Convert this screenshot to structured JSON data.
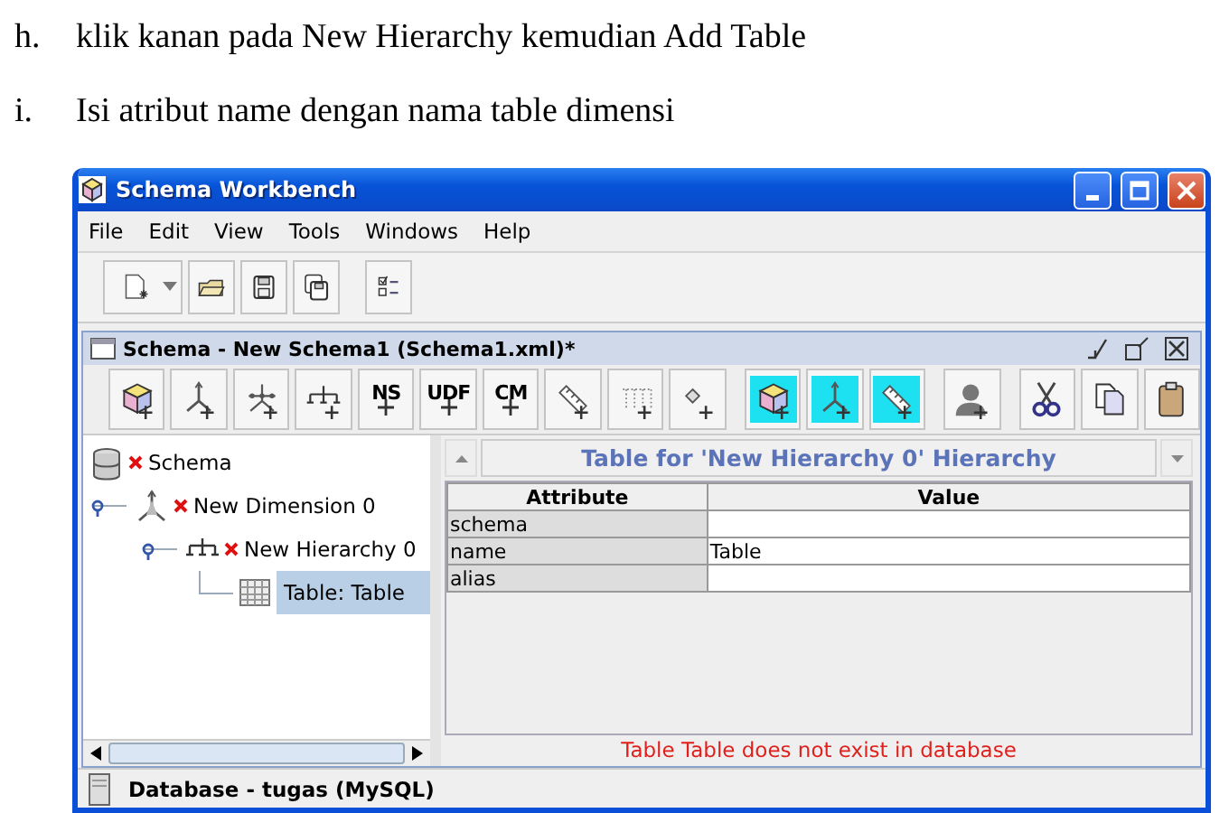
{
  "document": {
    "steps": [
      {
        "marker": "h.",
        "text": "klik kanan pada New Hierarchy kemudian Add Table"
      },
      {
        "marker": "i.",
        "text": "Isi atribut name dengan nama table dimensi"
      }
    ]
  },
  "window": {
    "title": "Schema Workbench"
  },
  "menu": [
    "File",
    "Edit",
    "View",
    "Tools",
    "Windows",
    "Help"
  ],
  "toolbar": [
    {
      "kind": "new"
    },
    {
      "kind": "open"
    },
    {
      "kind": "save"
    },
    {
      "kind": "save-as"
    },
    {
      "kind": "preferences"
    }
  ],
  "schema_frame": {
    "title": "Schema - New Schema1 (Schema1.xml)*",
    "toolbar": [
      {
        "kind": "cube",
        "highlighted": false
      },
      {
        "kind": "dimension",
        "highlighted": false
      },
      {
        "kind": "dimension-usage",
        "highlighted": false
      },
      {
        "kind": "hierarchy",
        "highlighted": false
      },
      {
        "kind": "text",
        "text": "NS",
        "highlighted": false
      },
      {
        "kind": "text",
        "text": "UDF",
        "highlighted": false
      },
      {
        "kind": "text",
        "text": "CM",
        "highlighted": false
      },
      {
        "kind": "level",
        "highlighted": false
      },
      {
        "kind": "property",
        "highlighted": false
      },
      {
        "kind": "measure",
        "highlighted": false
      },
      {
        "kind": "cube",
        "highlighted": true
      },
      {
        "kind": "dimension",
        "highlighted": true
      },
      {
        "kind": "level",
        "highlighted": true
      },
      {
        "kind": "role",
        "highlighted": false
      },
      {
        "kind": "cut",
        "highlighted": false
      },
      {
        "kind": "copy",
        "highlighted": false
      },
      {
        "kind": "paste",
        "highlighted": false
      }
    ],
    "tree": [
      {
        "label": "Schema",
        "kind": "schema",
        "error": true,
        "selected": false,
        "children": [
          {
            "label": "New Dimension 0",
            "kind": "dimension",
            "error": true,
            "selected": false,
            "expanded": true,
            "children": [
              {
                "label": "New Hierarchy 0",
                "kind": "hierarchy",
                "error": true,
                "selected": false,
                "expanded": true,
                "children": [
                  {
                    "label": "Table: Table",
                    "kind": "table",
                    "error": false,
                    "selected": true
                  }
                ]
              }
            ]
          }
        ]
      }
    ],
    "properties": {
      "title": "Table for 'New Hierarchy 0' Hierarchy",
      "columns": [
        "Attribute",
        "Value"
      ],
      "rows": [
        {
          "attribute": "schema"
        },
        {
          "attribute": "name",
          "value": "Table"
        },
        {
          "attribute": "alias"
        }
      ],
      "message": "Table Table does not exist in database"
    }
  },
  "status_bar": "Database - tugas (MySQL)"
}
